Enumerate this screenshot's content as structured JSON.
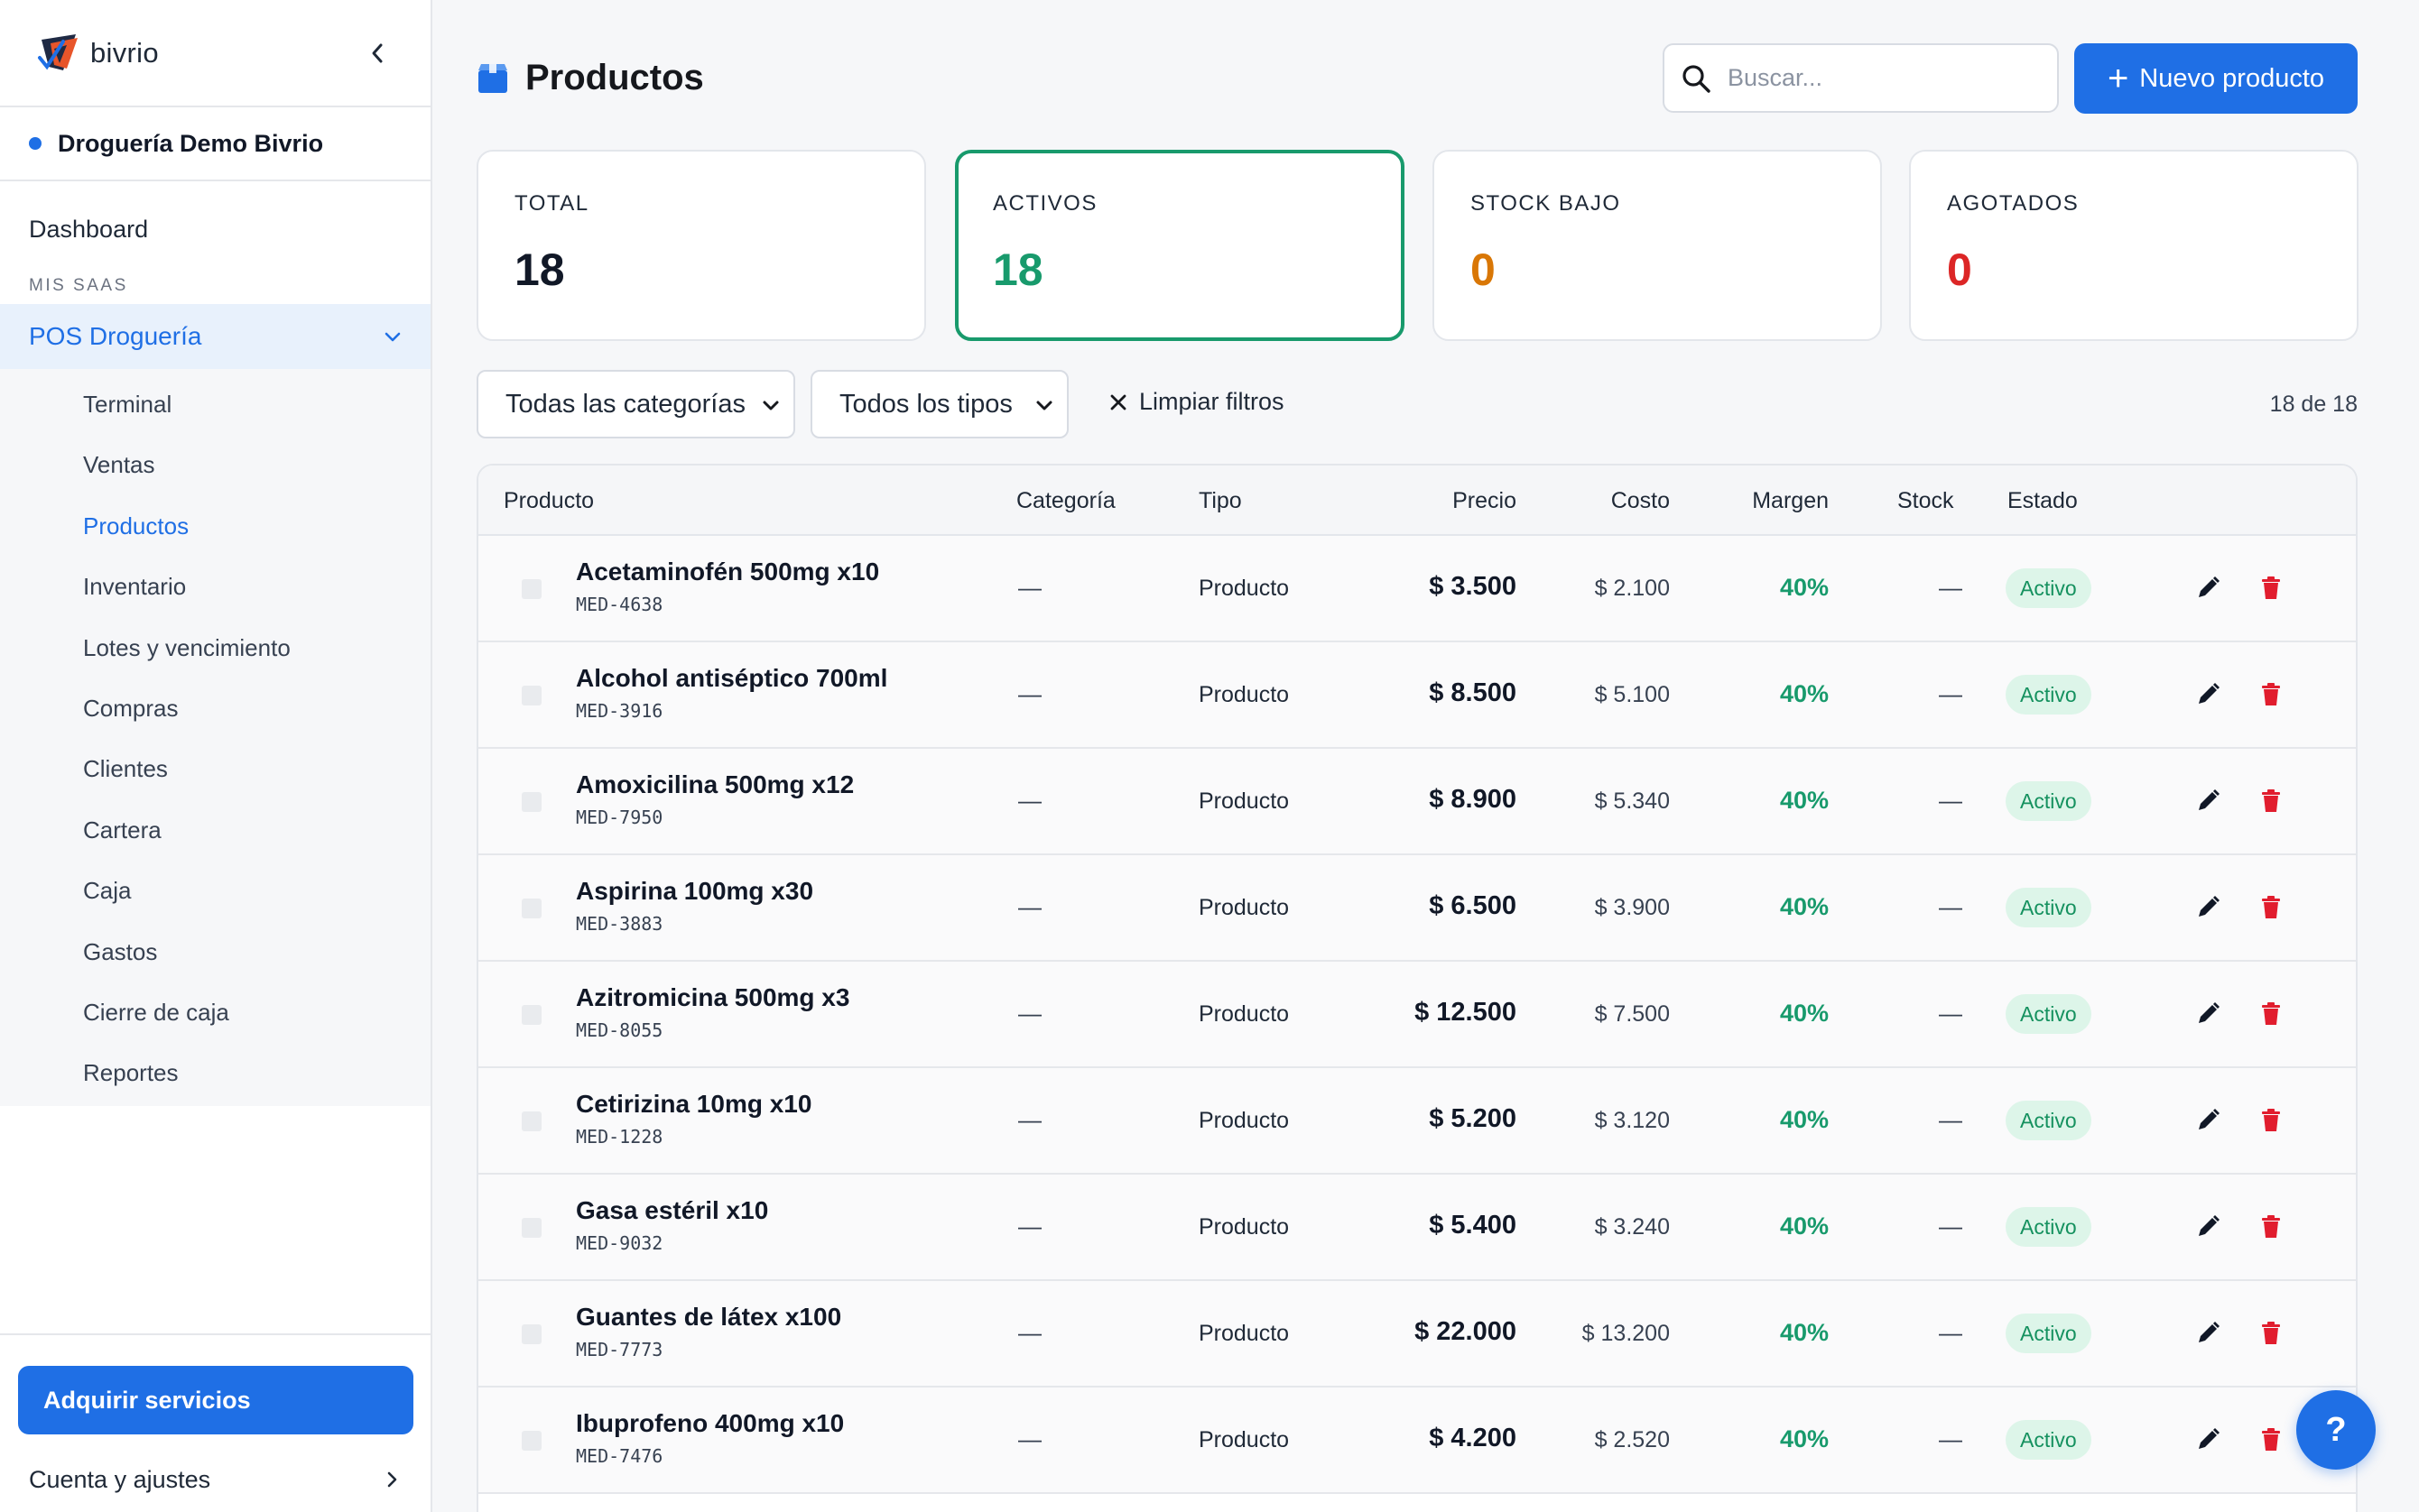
{
  "brand": {
    "name": "bivrio"
  },
  "org": {
    "name": "Droguería Demo Bivrio"
  },
  "nav": {
    "dashboard": "Dashboard",
    "section": "MIS SAAS",
    "group": "POS Droguería",
    "items": [
      {
        "label": "Terminal"
      },
      {
        "label": "Ventas"
      },
      {
        "label": "Productos",
        "active": true
      },
      {
        "label": "Inventario"
      },
      {
        "label": "Lotes y vencimiento"
      },
      {
        "label": "Compras"
      },
      {
        "label": "Clientes"
      },
      {
        "label": "Cartera"
      },
      {
        "label": "Caja"
      },
      {
        "label": "Gastos"
      },
      {
        "label": "Cierre de caja"
      },
      {
        "label": "Reportes"
      }
    ],
    "acquire": "Adquirir servicios",
    "account": "Cuenta y ajustes"
  },
  "header": {
    "title": "Productos",
    "search_placeholder": "Buscar...",
    "new_button": "Nuevo producto"
  },
  "stats": [
    {
      "label": "TOTAL",
      "value": "18",
      "color": "#111827"
    },
    {
      "label": "ACTIVOS",
      "value": "18",
      "color": "#189a6c"
    },
    {
      "label": "STOCK BAJO",
      "value": "0",
      "color": "#d97706"
    },
    {
      "label": "AGOTADOS",
      "value": "0",
      "color": "#dc2626"
    }
  ],
  "filters": {
    "category": "Todas las categorías",
    "type": "Todos los tipos",
    "clear": "Limpiar filtros",
    "count": "18 de 18"
  },
  "table": {
    "headers": {
      "producto": "Producto",
      "categoria": "Categoría",
      "tipo": "Tipo",
      "precio": "Precio",
      "costo": "Costo",
      "margen": "Margen",
      "stock": "Stock",
      "estado": "Estado"
    },
    "rows": [
      {
        "name": "Acetaminofén 500mg x10",
        "sku": "MED-4638",
        "category": "—",
        "type": "Producto",
        "price": "$ 3.500",
        "cost": "$ 2.100",
        "margin": "40%",
        "stock": "—",
        "status": "Activo"
      },
      {
        "name": "Alcohol antiséptico 700ml",
        "sku": "MED-3916",
        "category": "—",
        "type": "Producto",
        "price": "$ 8.500",
        "cost": "$ 5.100",
        "margin": "40%",
        "stock": "—",
        "status": "Activo"
      },
      {
        "name": "Amoxicilina 500mg x12",
        "sku": "MED-7950",
        "category": "—",
        "type": "Producto",
        "price": "$ 8.900",
        "cost": "$ 5.340",
        "margin": "40%",
        "stock": "—",
        "status": "Activo"
      },
      {
        "name": "Aspirina 100mg x30",
        "sku": "MED-3883",
        "category": "—",
        "type": "Producto",
        "price": "$ 6.500",
        "cost": "$ 3.900",
        "margin": "40%",
        "stock": "—",
        "status": "Activo"
      },
      {
        "name": "Azitromicina 500mg x3",
        "sku": "MED-8055",
        "category": "—",
        "type": "Producto",
        "price": "$ 12.500",
        "cost": "$ 7.500",
        "margin": "40%",
        "stock": "—",
        "status": "Activo"
      },
      {
        "name": "Cetirizina 10mg x10",
        "sku": "MED-1228",
        "category": "—",
        "type": "Producto",
        "price": "$ 5.200",
        "cost": "$ 3.120",
        "margin": "40%",
        "stock": "—",
        "status": "Activo"
      },
      {
        "name": "Gasa estéril x10",
        "sku": "MED-9032",
        "category": "—",
        "type": "Producto",
        "price": "$ 5.400",
        "cost": "$ 3.240",
        "margin": "40%",
        "stock": "—",
        "status": "Activo"
      },
      {
        "name": "Guantes de látex x100",
        "sku": "MED-7773",
        "category": "—",
        "type": "Producto",
        "price": "$ 22.000",
        "cost": "$ 13.200",
        "margin": "40%",
        "stock": "—",
        "status": "Activo"
      },
      {
        "name": "Ibuprofeno 400mg x10",
        "sku": "MED-7476",
        "category": "—",
        "type": "Producto",
        "price": "$ 4.200",
        "cost": "$ 2.520",
        "margin": "40%",
        "stock": "—",
        "status": "Activo"
      }
    ]
  },
  "help": {
    "label": "?"
  }
}
